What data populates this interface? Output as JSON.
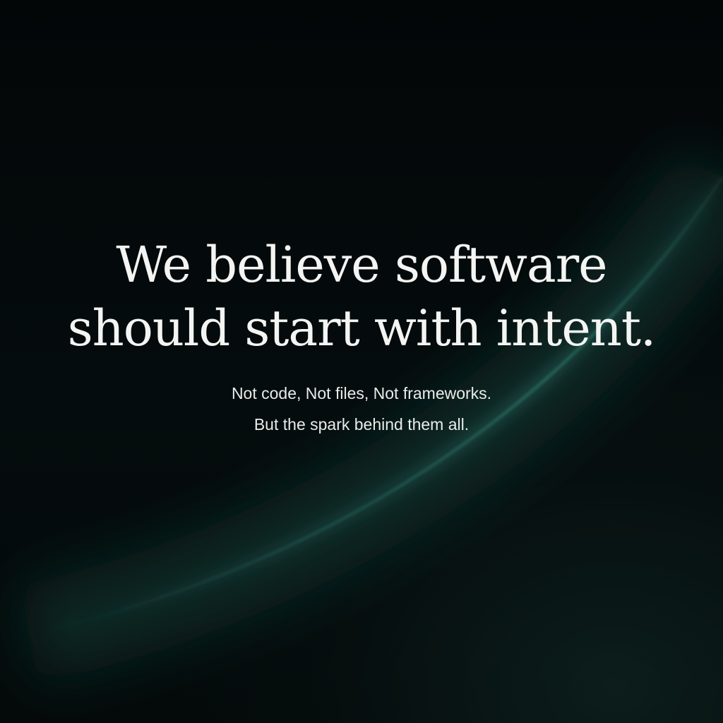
{
  "headline": {
    "line1": "We believe software",
    "line2": "should start with intent."
  },
  "subtext": {
    "line1": "Not code, Not files, Not frameworks.",
    "line2": "But the spark behind them all."
  },
  "colors": {
    "background": "#050a0b",
    "glow": "#2f7a6c",
    "text": "#f4f5f3"
  }
}
